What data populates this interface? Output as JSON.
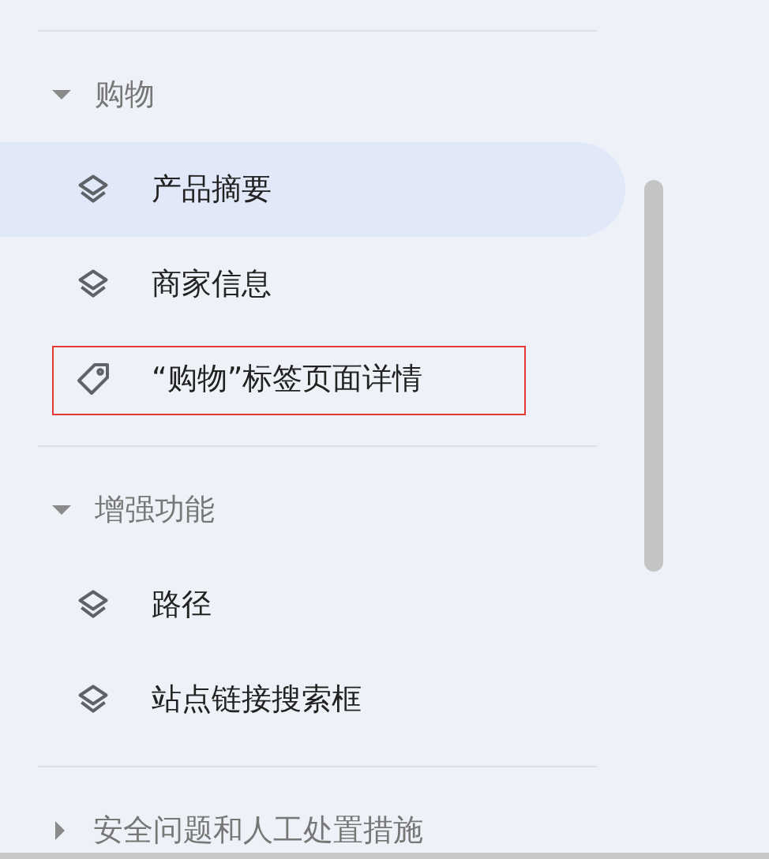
{
  "sections": [
    {
      "title": "购物",
      "expanded": true,
      "items": [
        {
          "label": "产品摘要",
          "kind": "layers",
          "selected": true,
          "outlined": false
        },
        {
          "label": "商家信息",
          "kind": "layers",
          "selected": false,
          "outlined": false
        },
        {
          "label": "“购物”标签页面详情",
          "kind": "tag",
          "selected": false,
          "outlined": true
        }
      ]
    },
    {
      "title": "增强功能",
      "expanded": true,
      "items": [
        {
          "label": "路径",
          "kind": "layers",
          "selected": false,
          "outlined": false
        },
        {
          "label": "站点链接搜索框",
          "kind": "layers",
          "selected": false,
          "outlined": false
        }
      ]
    },
    {
      "title": "安全问题和人工处置措施",
      "expanded": false
    }
  ]
}
